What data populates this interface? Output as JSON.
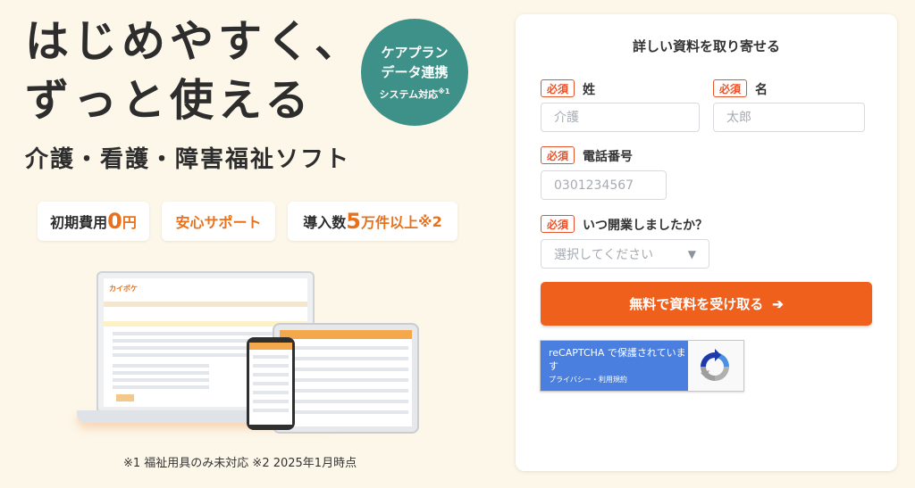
{
  "hero": {
    "headline_line1": "はじめやすく、",
    "headline_line2": "ずっと使える",
    "subhead": "介護・看護・障害福祉ソフト",
    "badge": {
      "line1": "ケアプラン",
      "line2": "データ連携",
      "line3": "システム対応",
      "line3_sup": "※1",
      "color": "#3e9188"
    },
    "features": [
      {
        "prefix": "初期費用",
        "highlight": "0",
        "suffix": "円"
      },
      {
        "label": "安心サポート"
      },
      {
        "prefix": "導入数",
        "highlight": "5",
        "suffix": "万件以上",
        "note": "※2"
      }
    ],
    "footnote": "※1 福祉用具のみ未対応 ※2 2025年1月時点",
    "mockup_logo": "カイポケ"
  },
  "form": {
    "title": "詳しい資料を取り寄せる",
    "required_label": "必須",
    "last_name_label": "姓",
    "last_name_placeholder": "介護",
    "first_name_label": "名",
    "first_name_placeholder": "太郎",
    "phone_label": "電話番号",
    "phone_placeholder": "0301234567",
    "opening_label": "いつ開業しましたか？",
    "opening_placeholder": "選択してください",
    "submit_label": "無料で資料を受け取る",
    "submit_arrow": "➔",
    "accent_color": "#f0601d"
  },
  "recaptcha": {
    "text": "reCAPTCHA で保護されています",
    "links": "プライバシー・利用規約"
  }
}
